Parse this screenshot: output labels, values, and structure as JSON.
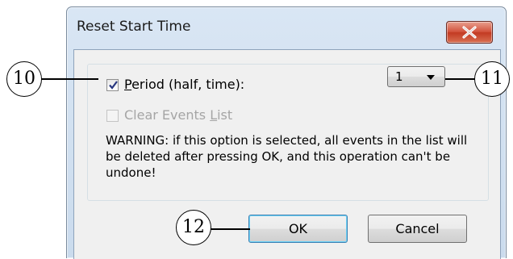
{
  "dialog": {
    "title": "Reset Start Time",
    "close_icon": "close-x-icon",
    "period": {
      "checked": true,
      "label_accel": "P",
      "label_rest": "eriod (half, time):",
      "selected_value": "1"
    },
    "clear_events": {
      "checked": false,
      "enabled": false,
      "label_pre": "Clear Events ",
      "label_accel": "L",
      "label_post": "ist"
    },
    "warning": "WARNING: if this option is selected, all events in the list will be deleted after pressing OK, and this operation can't be undone!",
    "ok_label": "OK",
    "cancel_label": "Cancel"
  },
  "callouts": {
    "c10": "10",
    "c11": "11",
    "c12": "12"
  },
  "colors": {
    "close_button": "#c9442c",
    "frame": "#cadbed",
    "client": "#f0f0f0",
    "check_mark": "#27367f"
  }
}
